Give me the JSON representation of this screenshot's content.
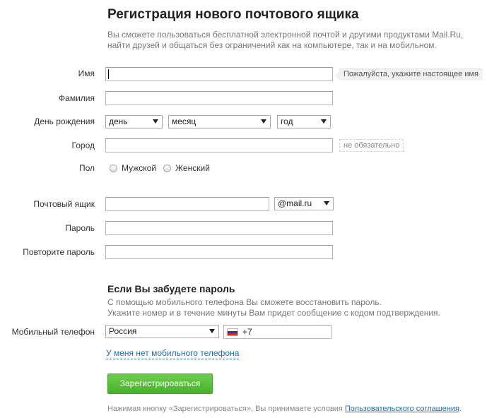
{
  "header": {
    "title": "Регистрация нового почтового ящика",
    "subtitle": "Вы сможете пользоваться бесплатной электронной почтой и другими продуктами Mail.Ru, найти друзей и общаться без ограничений как на компьютере, так и на мобильном."
  },
  "form": {
    "name_label": "Имя",
    "name_hint": "Пожалуйста, укажите настоящее имя",
    "surname_label": "Фамилия",
    "birthday_label": "День рождения",
    "day_value": "день",
    "month_value": "месяц",
    "year_value": "год",
    "city_label": "Город",
    "city_optional": "не обязательно",
    "gender_label": "Пол",
    "gender_male": "Мужской",
    "gender_female": "Женский",
    "mailbox_label": "Почтовый ящик",
    "domain_value": "@mail.ru",
    "password_label": "Пароль",
    "password_repeat_label": "Повторите пароль"
  },
  "recovery": {
    "title": "Если Вы забудете пароль",
    "text_line1": "С помощью мобильного телефона Вы сможете восстановить пароль.",
    "text_line2": "Укажите номер и в течение минуты Вам придет сообщение с кодом подтверждения.",
    "phone_label": "Мобильный телефон",
    "country_value": "Россия",
    "phone_prefix": "+7",
    "no_phone_link": "У меня нет мобильного телефона"
  },
  "submit": {
    "label": "Зарегистрироваться"
  },
  "terms": {
    "text": "Нажимая кнопку «Зарегистрироваться», Вы принимаете условия ",
    "link": "Пользовательского соглашения",
    "period": "."
  },
  "colors": {
    "button_green": "#48b12b",
    "link_blue": "#226dbb"
  }
}
